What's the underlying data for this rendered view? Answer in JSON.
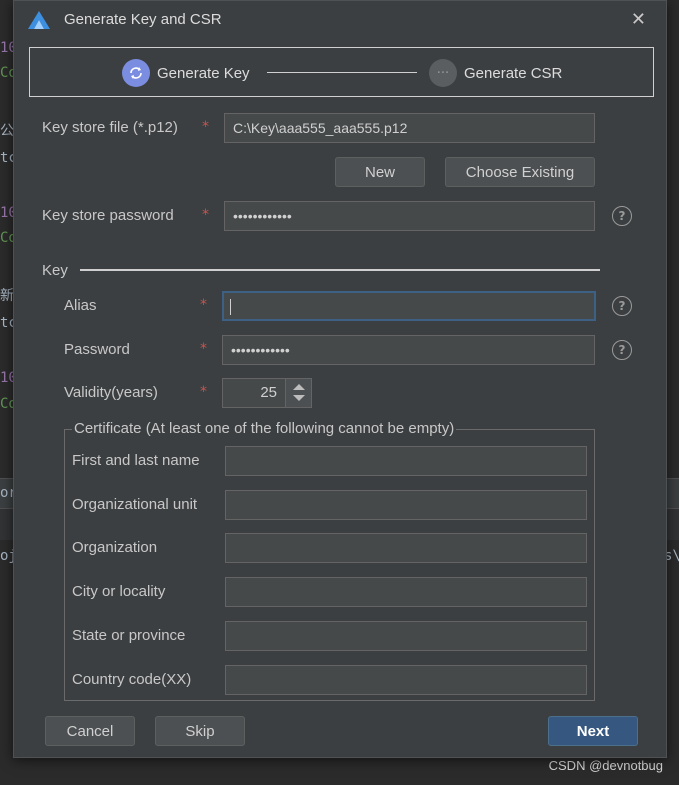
{
  "background": {
    "fragments": [
      "10",
      "Co",
      "公",
      "tc",
      "10",
      "Co",
      "新",
      "tc",
      "10",
      "Co",
      "or",
      "oj",
      "s\\"
    ]
  },
  "dialog": {
    "title": "Generate Key and CSR",
    "steps": [
      {
        "label": "Generate Key",
        "state": "active"
      },
      {
        "label": "Generate CSR",
        "state": "inactive"
      }
    ],
    "keystore_file": {
      "label": "Key store file (*.p12)",
      "value": "C:\\Key\\aaa555_aaa555.p12"
    },
    "new_button": "New",
    "choose_existing_button": "Choose Existing",
    "keystore_password": {
      "label": "Key store password",
      "value": "••••••••••••"
    },
    "required_mark": "*",
    "help_glyph": "?",
    "key_section": {
      "title": "Key",
      "alias": {
        "label": "Alias",
        "value": ""
      },
      "password": {
        "label": "Password",
        "value": "••••••••••••"
      },
      "validity": {
        "label": "Validity(years)",
        "value": "25"
      }
    },
    "certificate": {
      "title": "Certificate (At least one of the following cannot be empty)",
      "fields": [
        {
          "label": "First and last name",
          "value": ""
        },
        {
          "label": "Organizational unit",
          "value": ""
        },
        {
          "label": "Organization",
          "value": ""
        },
        {
          "label": "City or locality",
          "value": ""
        },
        {
          "label": "State or province",
          "value": ""
        },
        {
          "label": "Country code(XX)",
          "value": ""
        }
      ]
    },
    "cancel_button": "Cancel",
    "skip_button": "Skip",
    "next_button": "Next"
  },
  "watermark": "CSDN @devnotbug",
  "colors": {
    "dialog_bg": "#3c3f41",
    "accent": "#365880",
    "required": "#c75450",
    "step_active": "#7b8de0"
  }
}
